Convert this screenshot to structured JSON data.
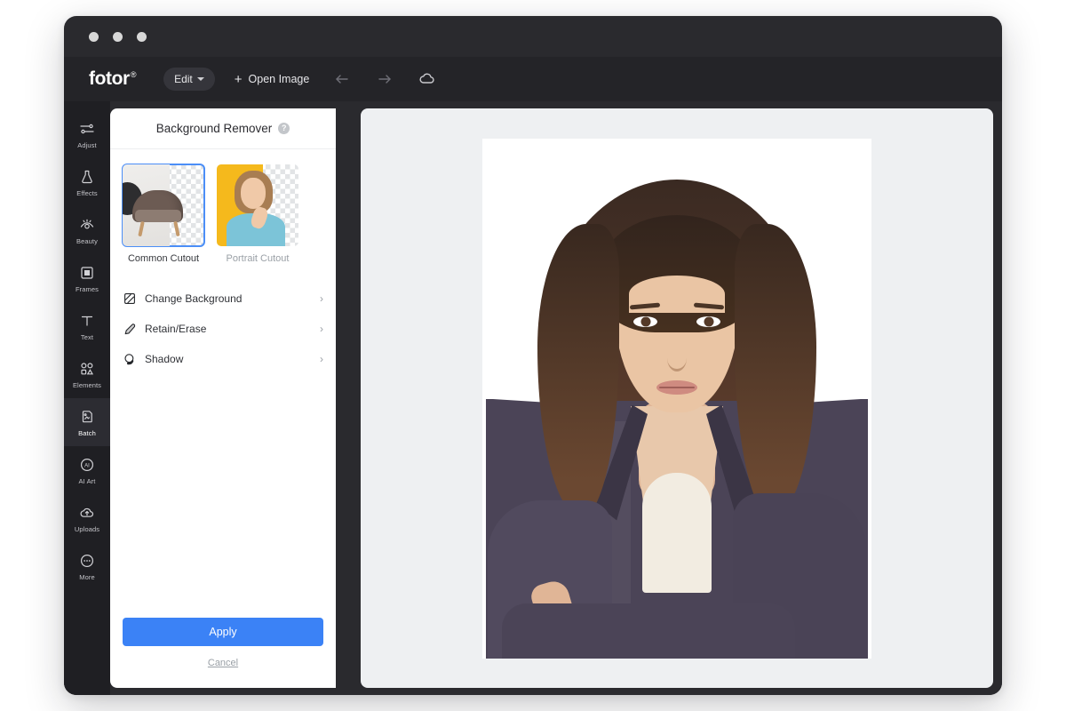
{
  "window": {
    "dots": [
      "close",
      "minimize",
      "maximize"
    ]
  },
  "toolbar": {
    "brand": "fotor",
    "brand_mark": "®",
    "edit_label": "Edit",
    "open_image_label": "Open Image",
    "plus_glyph": "+",
    "icons": [
      {
        "name": "undo-arrow-icon",
        "state": "dim"
      },
      {
        "name": "redo-arrow-icon",
        "state": "dim"
      },
      {
        "name": "cloud-save-icon",
        "state": "bright"
      }
    ]
  },
  "sidebar": {
    "items": [
      {
        "label": "Adjust",
        "icon": "sliders-icon",
        "active": false
      },
      {
        "label": "Effects",
        "icon": "flask-icon",
        "active": false
      },
      {
        "label": "Beauty",
        "icon": "eye-icon",
        "active": false
      },
      {
        "label": "Frames",
        "icon": "frame-icon",
        "active": false
      },
      {
        "label": "Text",
        "icon": "text-t-icon",
        "active": false
      },
      {
        "label": "Elements",
        "icon": "shapes-icon",
        "active": false
      },
      {
        "label": "Batch",
        "icon": "batch-image-icon",
        "active": true
      },
      {
        "label": "AI Art",
        "icon": "ai-circle-icon",
        "active": false
      },
      {
        "label": "Uploads",
        "icon": "upload-cloud-icon",
        "active": false
      },
      {
        "label": "More",
        "icon": "ellipsis-circle-icon",
        "active": false
      }
    ]
  },
  "panel": {
    "title": "Background Remover",
    "help_glyph": "?",
    "cutouts": [
      {
        "label": "Common Cutout",
        "selected": true
      },
      {
        "label": "Portrait Cutout",
        "selected": false
      }
    ],
    "rows": [
      {
        "label": "Change Background",
        "icon": "hatched-square-icon",
        "chevron": "›"
      },
      {
        "label": "Retain/Erase",
        "icon": "eraser-pen-icon",
        "chevron": "›"
      },
      {
        "label": "Shadow",
        "icon": "shadow-sphere-icon",
        "chevron": "›"
      }
    ],
    "apply_label": "Apply",
    "cancel_label": "Cancel"
  },
  "canvas": {
    "image_alt": "Portrait of a woman with dark wavy hair wearing a dark purple blazer over a cream top, arms crossed, on a white background"
  },
  "colors": {
    "accent_blue": "#3b82f6",
    "window_chrome": "#2a2a2e",
    "toolbar": "#242428",
    "rail": "#1f1f23",
    "canvas_bg": "#eef0f2",
    "panel_bg": "#ffffff",
    "blazer": "#4b4457",
    "thumb_accent_yellow": "#f5b91c"
  }
}
